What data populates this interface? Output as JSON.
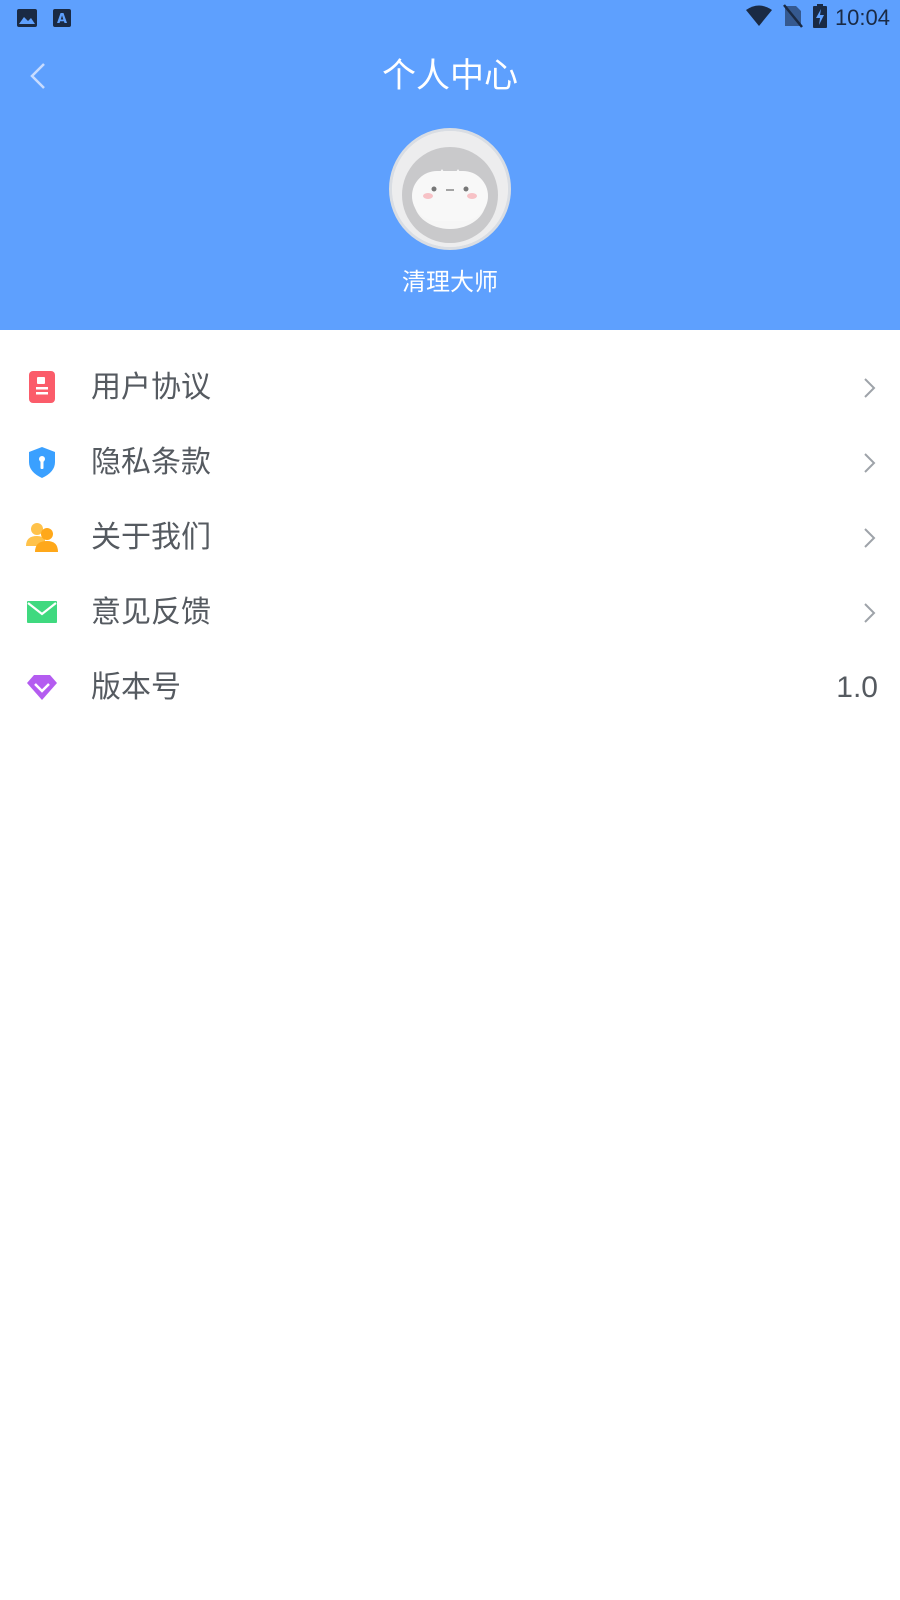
{
  "status_bar": {
    "time": "10:04"
  },
  "header": {
    "title": "个人中心",
    "username": "清理大师"
  },
  "menu": {
    "items": [
      {
        "label": "用户协议",
        "icon": "document-icon",
        "color": "#fb5c6a"
      },
      {
        "label": "隐私条款",
        "icon": "shield-icon",
        "color": "#3aa0ff"
      },
      {
        "label": "关于我们",
        "icon": "users-icon",
        "color": "#ffb42a"
      },
      {
        "label": "意见反馈",
        "icon": "mail-icon",
        "color": "#3fd97f"
      },
      {
        "label": "版本号",
        "icon": "diamond-icon",
        "color": "#b45cf0",
        "value": "1.0"
      }
    ]
  },
  "colors": {
    "header_bg": "#5ea0fe",
    "text": "#555a60"
  }
}
